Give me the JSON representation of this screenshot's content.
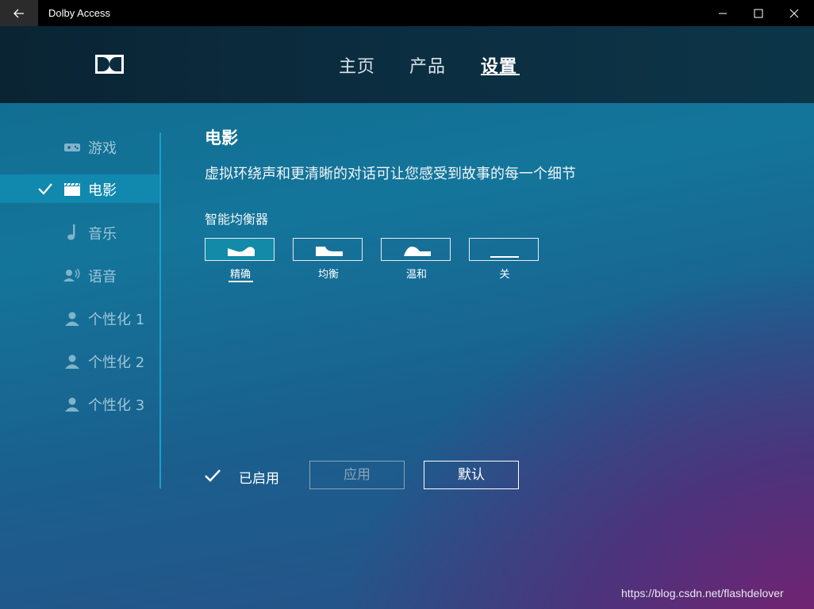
{
  "titlebar": {
    "app_title": "Dolby Access",
    "back_icon": "arrow-left-icon",
    "minimize_icon": "minimize-icon",
    "maximize_icon": "maximize-icon",
    "close_icon": "close-icon"
  },
  "header": {
    "logo_icon": "dolby-logo-icon",
    "nav": [
      {
        "label": "主页",
        "active": false
      },
      {
        "label": "产品",
        "active": false
      },
      {
        "label": "设置",
        "active": true
      }
    ]
  },
  "sidebar": {
    "items": [
      {
        "label": "游戏",
        "icon": "gamepad-icon",
        "active": false
      },
      {
        "label": "电影",
        "icon": "film-clapper-icon",
        "active": true
      },
      {
        "label": "音乐",
        "icon": "music-note-icon",
        "active": false
      },
      {
        "label": "语音",
        "icon": "voice-user-icon",
        "active": false
      },
      {
        "label": "个性化 1",
        "icon": "person-icon",
        "active": false
      },
      {
        "label": "个性化 2",
        "icon": "person-icon",
        "active": false
      },
      {
        "label": "个性化 3",
        "icon": "person-icon",
        "active": false
      }
    ]
  },
  "main": {
    "title": "电影",
    "description": "虚拟环绕声和更清晰的对话可让您感受到故事的每一个细节",
    "equalizer": {
      "label": "智能均衡器",
      "options": [
        {
          "label": "精确",
          "icon": "eq-detailed-icon",
          "selected": true
        },
        {
          "label": "均衡",
          "icon": "eq-balanced-icon",
          "selected": false
        },
        {
          "label": "温和",
          "icon": "eq-warm-icon",
          "selected": false
        },
        {
          "label": "关",
          "icon": "eq-off-icon",
          "selected": false
        }
      ]
    },
    "enabled_label": "已启用",
    "apply_label": "应用",
    "default_label": "默认"
  },
  "watermark": "https://blog.csdn.net/flashdelover",
  "colors": {
    "titlebar": "#000000",
    "header": "#0b2c3e",
    "sidebar_active": "#1188ad",
    "divider": "#1aa0c8",
    "eq_selected": "#128aa8"
  }
}
